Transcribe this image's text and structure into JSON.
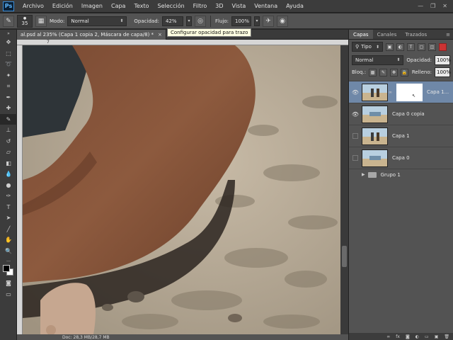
{
  "app": {
    "logo": "Ps"
  },
  "menu": [
    "Archivo",
    "Edición",
    "Imagen",
    "Capa",
    "Texto",
    "Selección",
    "Filtro",
    "3D",
    "Vista",
    "Ventana",
    "Ayuda"
  ],
  "options": {
    "brush_size": "35",
    "mode_label": "Modo:",
    "mode_value": "Normal",
    "opacity_label": "Opacidad:",
    "opacity_value": "42%",
    "flow_label": "Flujo:",
    "flow_value": "100%"
  },
  "tooltip": "Configurar opacidad para trazo",
  "document": {
    "tab_title": "al.psd al 235% (Capa 1 copia 2, Máscara de capa/8) *",
    "close": "×",
    "ruler_mark": "7",
    "status": "Doc: 28,3 MB/28,7 MB"
  },
  "panel": {
    "tabs": [
      "Capas",
      "Canales",
      "Trazados"
    ],
    "filter_label": "Tipo",
    "blend_mode": "Normal",
    "opacity_label": "Opacidad:",
    "opacity_value": "100%",
    "lock_label": "Bloq.:",
    "fill_label": "Relleno:",
    "fill_value": "100%",
    "layers": [
      {
        "name": "Capa 1...",
        "visible": true,
        "selected": true,
        "mask": true
      },
      {
        "name": "Capa 0 copia",
        "visible": true,
        "selected": false,
        "mask": false
      },
      {
        "name": "Capa 1",
        "visible": false,
        "selected": false,
        "mask": false
      },
      {
        "name": "Capa 0",
        "visible": false,
        "selected": false,
        "mask": false
      }
    ],
    "group": {
      "name": "Grupo 1"
    }
  },
  "colors": {
    "accent": "#6f88a8",
    "foreground": "#000000",
    "background": "#ffffff"
  }
}
